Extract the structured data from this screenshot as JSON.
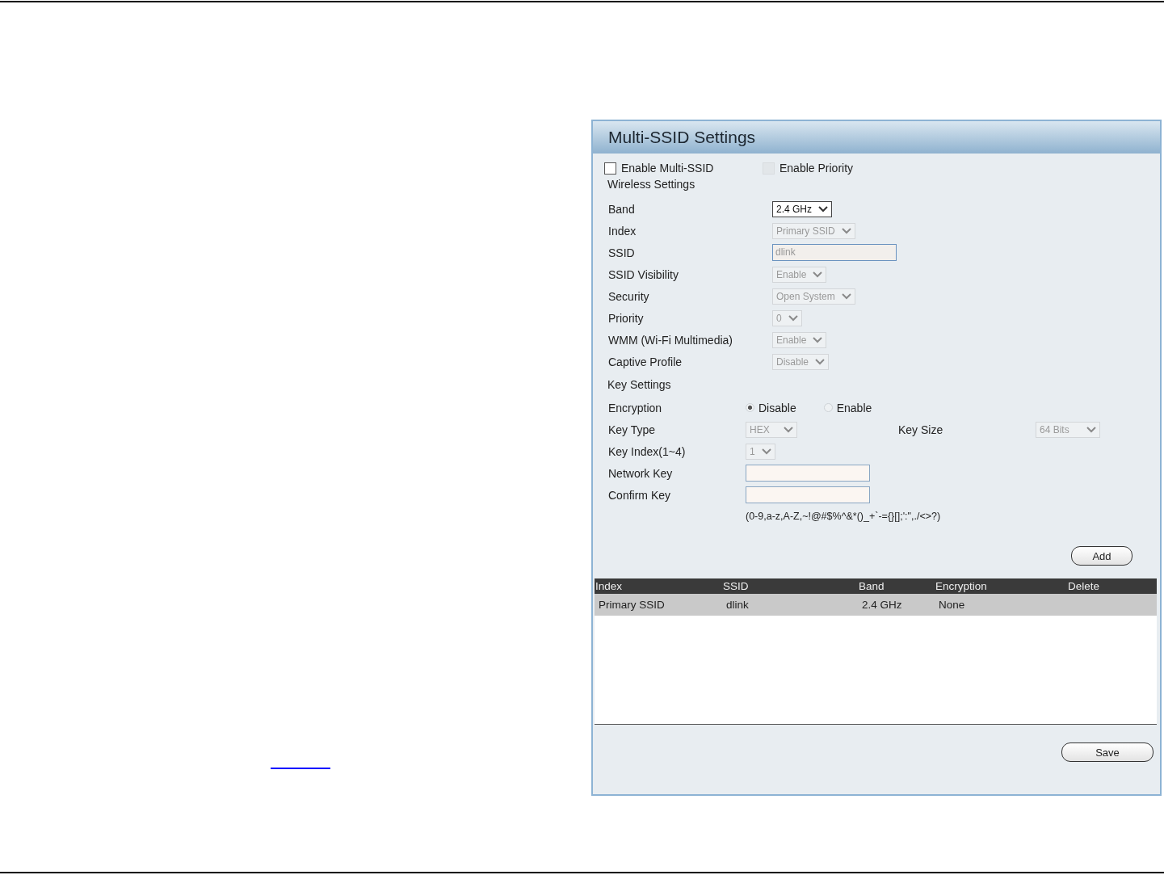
{
  "panel": {
    "title": "Multi-SSID Settings"
  },
  "options": [
    {
      "label": "Enable Multi-SSID",
      "checked": false,
      "disabled": false
    },
    {
      "label": "Enable Priority",
      "checked": false,
      "disabled": true
    }
  ],
  "wireless_section": "Wireless Settings",
  "wireless_fields": [
    {
      "label": "Band",
      "kind": "select",
      "value": "2.4 GHz",
      "disabled": false
    },
    {
      "label": "Index",
      "kind": "select",
      "value": "Primary SSID",
      "disabled": true
    },
    {
      "label": "SSID",
      "kind": "text",
      "value": "dlink",
      "disabled": true
    },
    {
      "label": "SSID Visibility",
      "kind": "select",
      "value": "Enable",
      "disabled": true
    },
    {
      "label": "Security",
      "kind": "select",
      "value": "Open System",
      "disabled": true
    },
    {
      "label": "Priority",
      "kind": "select",
      "value": "0",
      "disabled": true
    },
    {
      "label": "WMM (Wi-Fi Multimedia)",
      "kind": "select",
      "value": "Enable",
      "disabled": true
    },
    {
      "label": "Captive Profile",
      "kind": "select",
      "value": "Disable",
      "disabled": true
    }
  ],
  "key_section": "Key Settings",
  "encryption": {
    "label": "Encryption",
    "options": [
      {
        "label": "Disable",
        "selected": true
      },
      {
        "label": "Enable",
        "selected": false
      }
    ]
  },
  "key_type": {
    "label": "Key Type",
    "value": "HEX",
    "disabled": true
  },
  "key_size": {
    "label": "Key Size",
    "value": "64 Bits",
    "disabled": true
  },
  "key_index": {
    "label": "Key Index(1~4)",
    "value": "1",
    "disabled": true
  },
  "network_key": {
    "label": "Network Key"
  },
  "confirm_key": {
    "label": "Confirm Key"
  },
  "key_hint": "(0-9,a-z,A-Z,~!@#$%^&*()_+`-={}[];':\",./<>?)",
  "add_button": "Add",
  "table": {
    "columns": [
      "Index",
      "SSID",
      "Band",
      "Encryption",
      "Delete"
    ],
    "rows": [
      {
        "cells": [
          "Primary SSID",
          "dlink",
          "2.4 GHz",
          "None"
        ]
      }
    ]
  },
  "save_button": "Save"
}
